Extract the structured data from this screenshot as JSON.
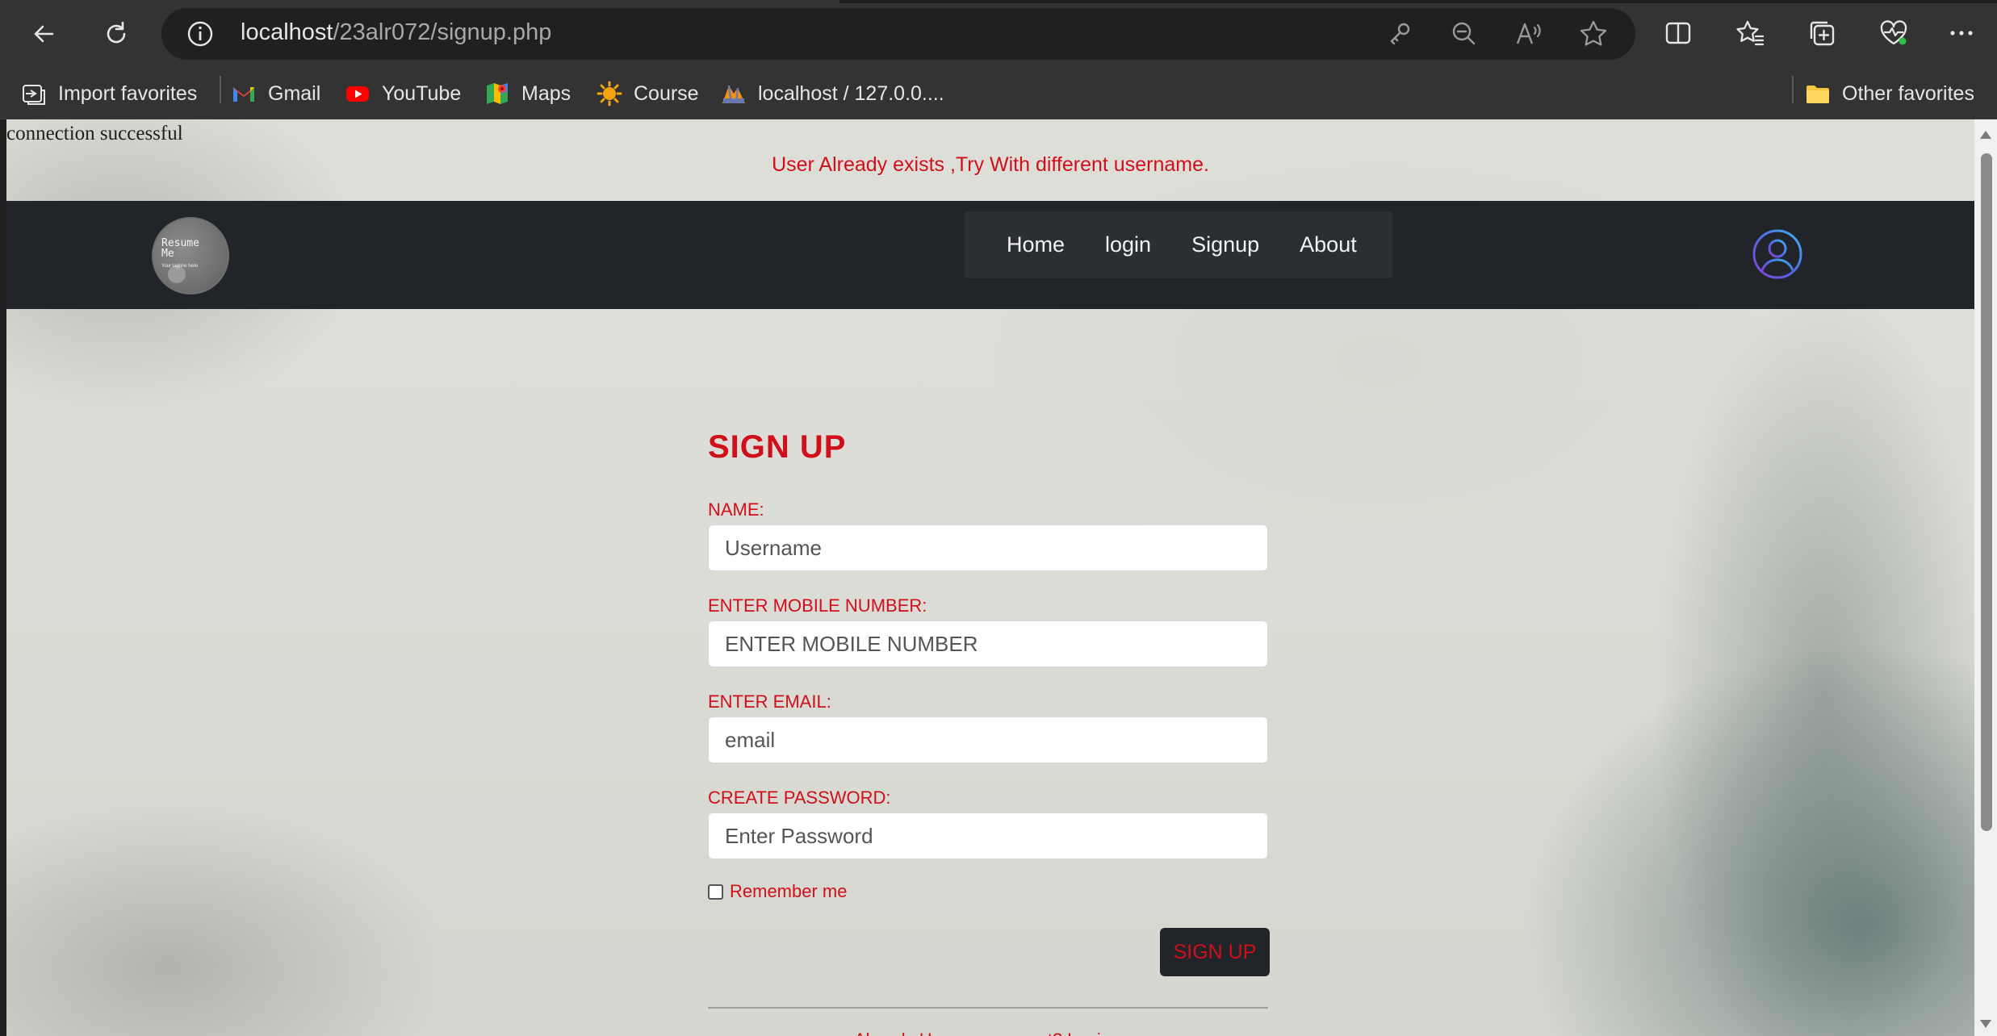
{
  "browser": {
    "url_host": "localhost",
    "url_path": "/23alr072/signup.php",
    "bookmarks": [
      {
        "label": "Import favorites",
        "icon": "import-favorites-icon"
      },
      {
        "label": "Gmail",
        "icon": "gmail-icon"
      },
      {
        "label": "YouTube",
        "icon": "youtube-icon"
      },
      {
        "label": "Maps",
        "icon": "maps-icon"
      },
      {
        "label": "Course",
        "icon": "course-icon"
      },
      {
        "label": "localhost / 127.0.0....",
        "icon": "phpmyadmin-icon"
      }
    ],
    "other_favorites": "Other favorites"
  },
  "page": {
    "connection_message": "connection successful",
    "alert_message": "User Already exists ,Try With different username.",
    "logo_text_line1": "Resume",
    "logo_text_line2": "Me",
    "logo_subtext": "Your tagline here",
    "nav": [
      {
        "label": "Home"
      },
      {
        "label": "login"
      },
      {
        "label": "Signup"
      },
      {
        "label": "About"
      }
    ]
  },
  "form": {
    "title": "SIGN UP",
    "name_label": "NAME:",
    "name_placeholder": "Username",
    "mobile_label": "ENTER MOBILE NUMBER:",
    "mobile_placeholder": "ENTER MOBILE NUMBER",
    "email_label": "ENTER EMAIL:",
    "email_placeholder": "email",
    "password_label": "CREATE PASSWORD:",
    "password_placeholder": "Enter Password",
    "remember_label": "Remember me",
    "submit_label": "SIGN UP",
    "bottom_text": "Already Have an account? Login"
  },
  "colors": {
    "accent": "#d10f1a",
    "navbar": "#212529"
  }
}
